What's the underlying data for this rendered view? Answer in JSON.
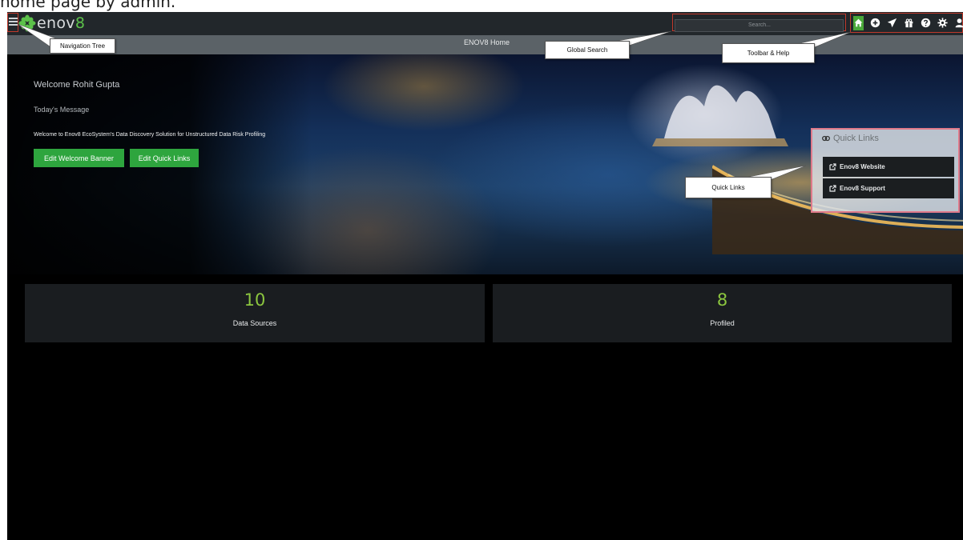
{
  "caption": "home page by admin.",
  "app": {
    "logo_prefix": "enov",
    "logo_suffix": "8",
    "search_placeholder": "Search...",
    "subbar_title": "ENOV8 Home",
    "accent_color": "#5cc14a",
    "button_color": "#2ea53e",
    "toolbar_icons": [
      "home-icon",
      "plus-circle-icon",
      "rocket-icon",
      "gift-icon",
      "help-icon",
      "gear-icon",
      "user-icon"
    ]
  },
  "hero": {
    "welcome": "Welcome Rohit Gupta",
    "todays_message_label": "Today's Message",
    "message": "Welcome to Enov8 EcoSystem's Data Discovery Solution for Unstructured Data Risk Profiling",
    "edit_banner_label": "Edit Welcome Banner",
    "edit_quick_links_label": "Edit Quick Links"
  },
  "quick_links": {
    "title": "Quick Links",
    "items": [
      {
        "label": "Enov8 Website"
      },
      {
        "label": "Enov8 Support"
      }
    ]
  },
  "stats": [
    {
      "value": "10",
      "label": "Data Sources"
    },
    {
      "value": "8",
      "label": "Profiled"
    }
  ],
  "callouts": {
    "navigation_tree": "Navigation Tree",
    "global_search": "Global Search",
    "toolbar_help": "Toolbar & Help",
    "quick_links": "Quick Links"
  }
}
